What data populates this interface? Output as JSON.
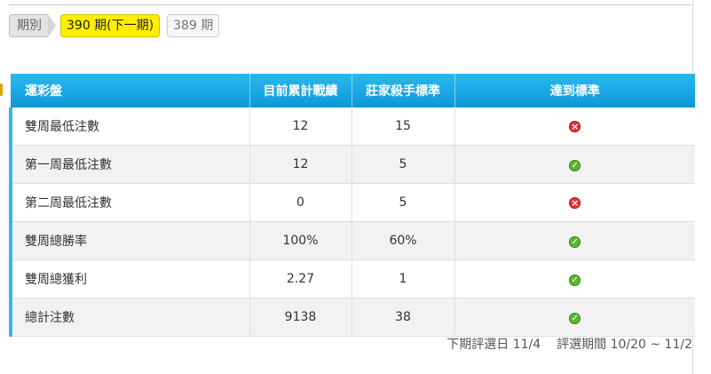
{
  "period_bar": {
    "label": "期別",
    "current": "390 期(下一期)",
    "previous": "389 期"
  },
  "table": {
    "headers": [
      "運彩盤",
      "目前累計戰績",
      "莊家殺手標準",
      "達到標準"
    ],
    "rows": [
      {
        "name": "雙周最低注數",
        "current": "12",
        "standard": "15",
        "met": false
      },
      {
        "name": "第一周最低注數",
        "current": "12",
        "standard": "5",
        "met": true
      },
      {
        "name": "第二周最低注數",
        "current": "0",
        "standard": "5",
        "met": false
      },
      {
        "name": "雙周總勝率",
        "current": "100%",
        "standard": "60%",
        "met": true
      },
      {
        "name": "雙周總獲利",
        "current": "2.27",
        "standard": "1",
        "met": true
      },
      {
        "name": "總計注數",
        "current": "9138",
        "standard": "38",
        "met": true
      }
    ]
  },
  "footer": {
    "next_date": "下期評選日 11/4",
    "period": "評選期間 10/20 ~ 11/2"
  },
  "icons": {
    "not_met": "cross-icon",
    "met": "check-icon"
  },
  "colors": {
    "header_blue": "#0c98d8",
    "highlight_yellow": "#ffee00",
    "cross_red": "#e53030",
    "check_green": "#5cb531"
  }
}
